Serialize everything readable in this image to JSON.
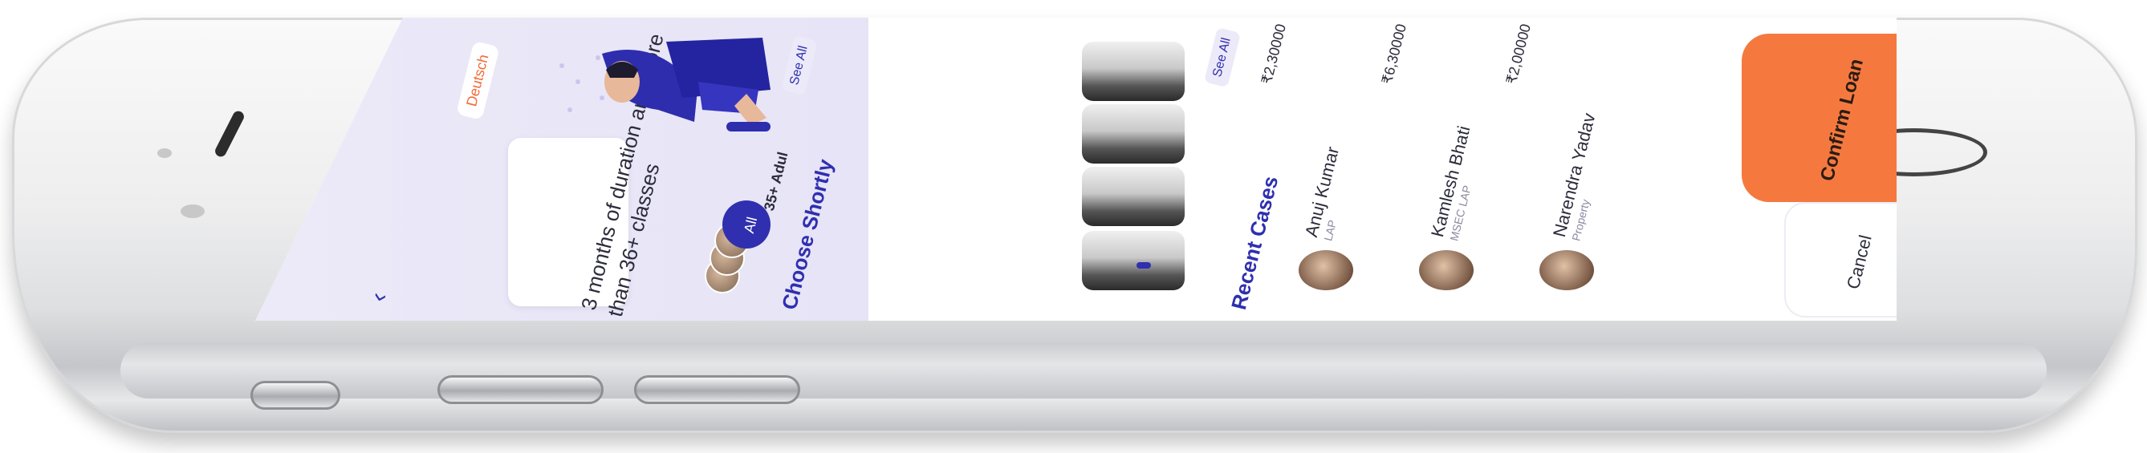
{
  "hero": {
    "language_pill": "Deutsch",
    "subtitle_line1": "3 months of duration and more",
    "subtitle_line2": "than 36+ classes",
    "all_badge": "All",
    "adult_label": "35+ Adul"
  },
  "choose_shortly": {
    "title": "Choose Shortly",
    "see_all": "See All"
  },
  "recent_cases": {
    "title": "Recent Cases",
    "see_all": "See All",
    "amounts": [
      "₹2,30000",
      "₹6,30000",
      "₹2,00000"
    ],
    "items": [
      {
        "name": "Anuj Kumar",
        "sub": "LAP"
      },
      {
        "name": "Kamlesh Bhati",
        "sub": "MSEC LAP"
      },
      {
        "name": "Narendra Yadav",
        "sub": "Property"
      }
    ]
  },
  "actions": {
    "confirm_label": "Confirm Loan",
    "cancel_label": "Cancel"
  },
  "icons": {
    "back": "chevron-left-icon"
  },
  "colors": {
    "accent": "#2f2fb0",
    "confirm": "#f5793f",
    "pill_text": "#f26b3a",
    "hero_bg": "#e6e4f6"
  }
}
